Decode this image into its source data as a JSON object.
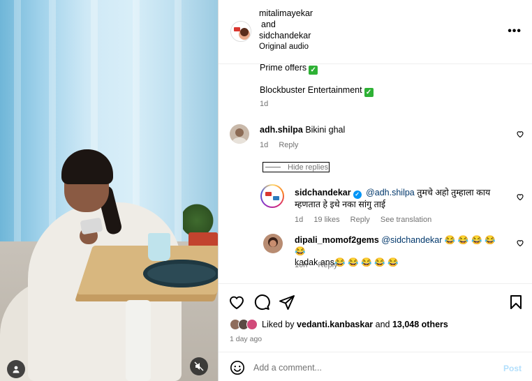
{
  "header": {
    "author1": "mitalimayekar",
    "joiner": "and",
    "author2": "sidchandekar",
    "audio": "Original audio"
  },
  "comments": {
    "caption_line1": "Prime offers",
    "caption_line2": "Blockbuster Entertainment",
    "caption_time": "1d",
    "c1": {
      "username": "adh.shilpa",
      "text": "Bikini ghal",
      "time": "1d",
      "reply_label": "Reply",
      "hide_replies": "Hide replies"
    },
    "r1": {
      "username": "sidchandekar",
      "mention": "@adh.shilpa",
      "text": "तुमचे अहो तुम्हाला काय म्हणतात हे इथे नका सांगु ताई",
      "time": "1d",
      "likes": "19 likes",
      "reply_label": "Reply",
      "translate": "See translation"
    },
    "r2": {
      "username": "dipali_momof2gems",
      "mention": "@sidchandekar",
      "text": "😂 😂 😂 😂 😂",
      "text2": "kadak ans😂 😂 😂 😂 😂",
      "time": "10h",
      "reply_label": "Reply"
    }
  },
  "actions": {
    "liked_by_prefix": "Liked by",
    "liked_by_user": "vedanti.kanbaskar",
    "liked_by_and": "and",
    "liked_by_count": "13,048 others",
    "time_ago": "1 day ago"
  },
  "composer": {
    "placeholder": "Add a comment...",
    "post_label": "Post"
  },
  "icons": {
    "like": "heart-icon",
    "comment": "comment-icon",
    "share": "share-icon",
    "save": "bookmark-icon",
    "emoji": "emoji-icon",
    "more": "more-icon",
    "mute": "muted-speaker-icon",
    "tags": "user-tag-icon"
  },
  "colors": {
    "verified": "#0095f6",
    "checkmark": "#2eb135",
    "mention": "#00376b",
    "post_disabled": "#b2dffc"
  }
}
